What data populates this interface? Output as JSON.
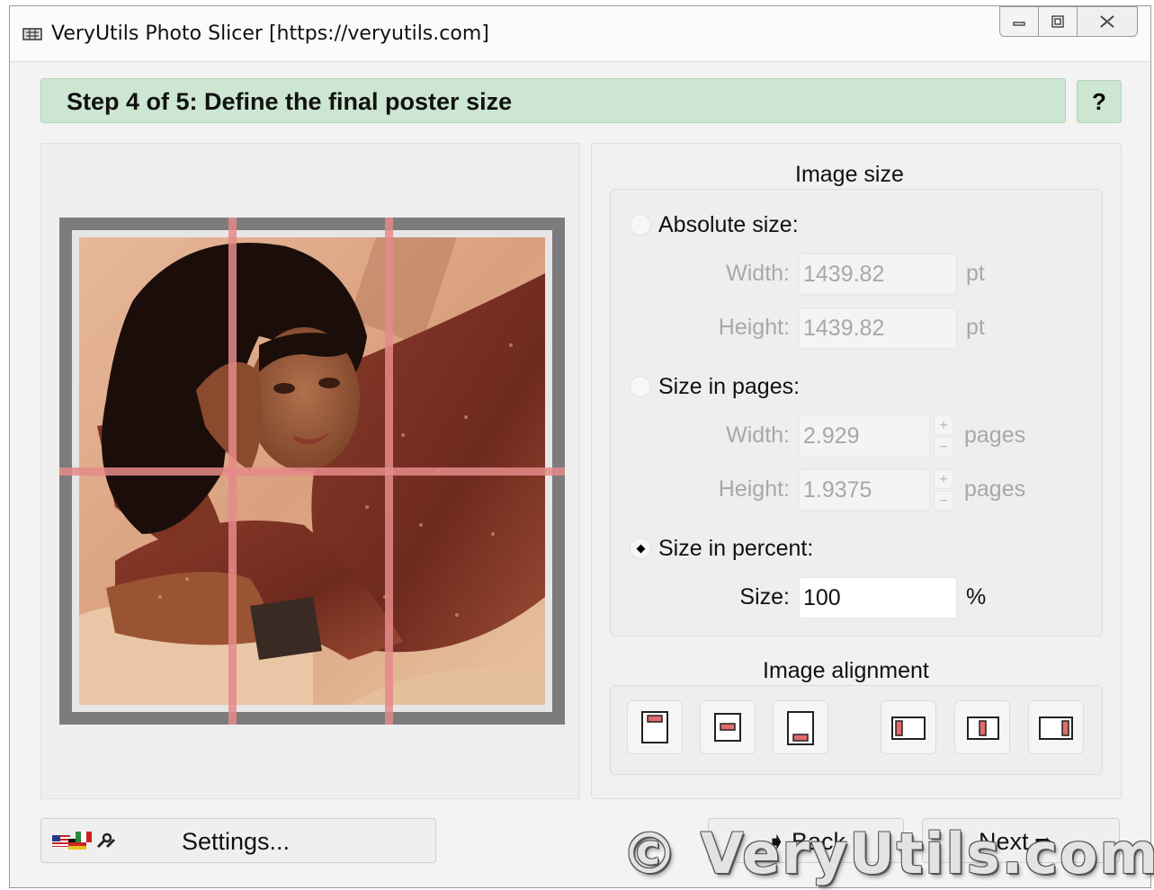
{
  "window": {
    "title": "VeryUtils Photo Slicer [https://veryutils.com]"
  },
  "step": {
    "title": "Step 4 of 5: Define the final poster size",
    "help_label": "?"
  },
  "image_size": {
    "section_title": "Image size",
    "absolute": {
      "label": "Absolute size:",
      "checked": false,
      "width_label": "Width:",
      "width_value": "1439.82",
      "width_unit": "pt",
      "height_label": "Height:",
      "height_value": "1439.82",
      "height_unit": "pt"
    },
    "pages": {
      "label": "Size in pages:",
      "checked": false,
      "width_label": "Width:",
      "width_value": "2.929",
      "width_unit": "pages",
      "height_label": "Height:",
      "height_value": "1.9375",
      "height_unit": "pages"
    },
    "percent": {
      "label": "Size in percent:",
      "checked": true,
      "size_label": "Size:",
      "size_value": "100",
      "size_unit": "%"
    }
  },
  "alignment": {
    "section_title": "Image alignment",
    "buttons": [
      "align-top",
      "align-middle",
      "align-bottom",
      "align-left",
      "align-center",
      "align-right"
    ]
  },
  "footer": {
    "settings_label": "Settings...",
    "back_label": "Back",
    "next_label": "Next"
  },
  "watermark": "© VeryUtils.com",
  "colors": {
    "step_bar": "#cde6d2",
    "grid_line": "#e58a8a",
    "frame": "#7c7c7c"
  }
}
